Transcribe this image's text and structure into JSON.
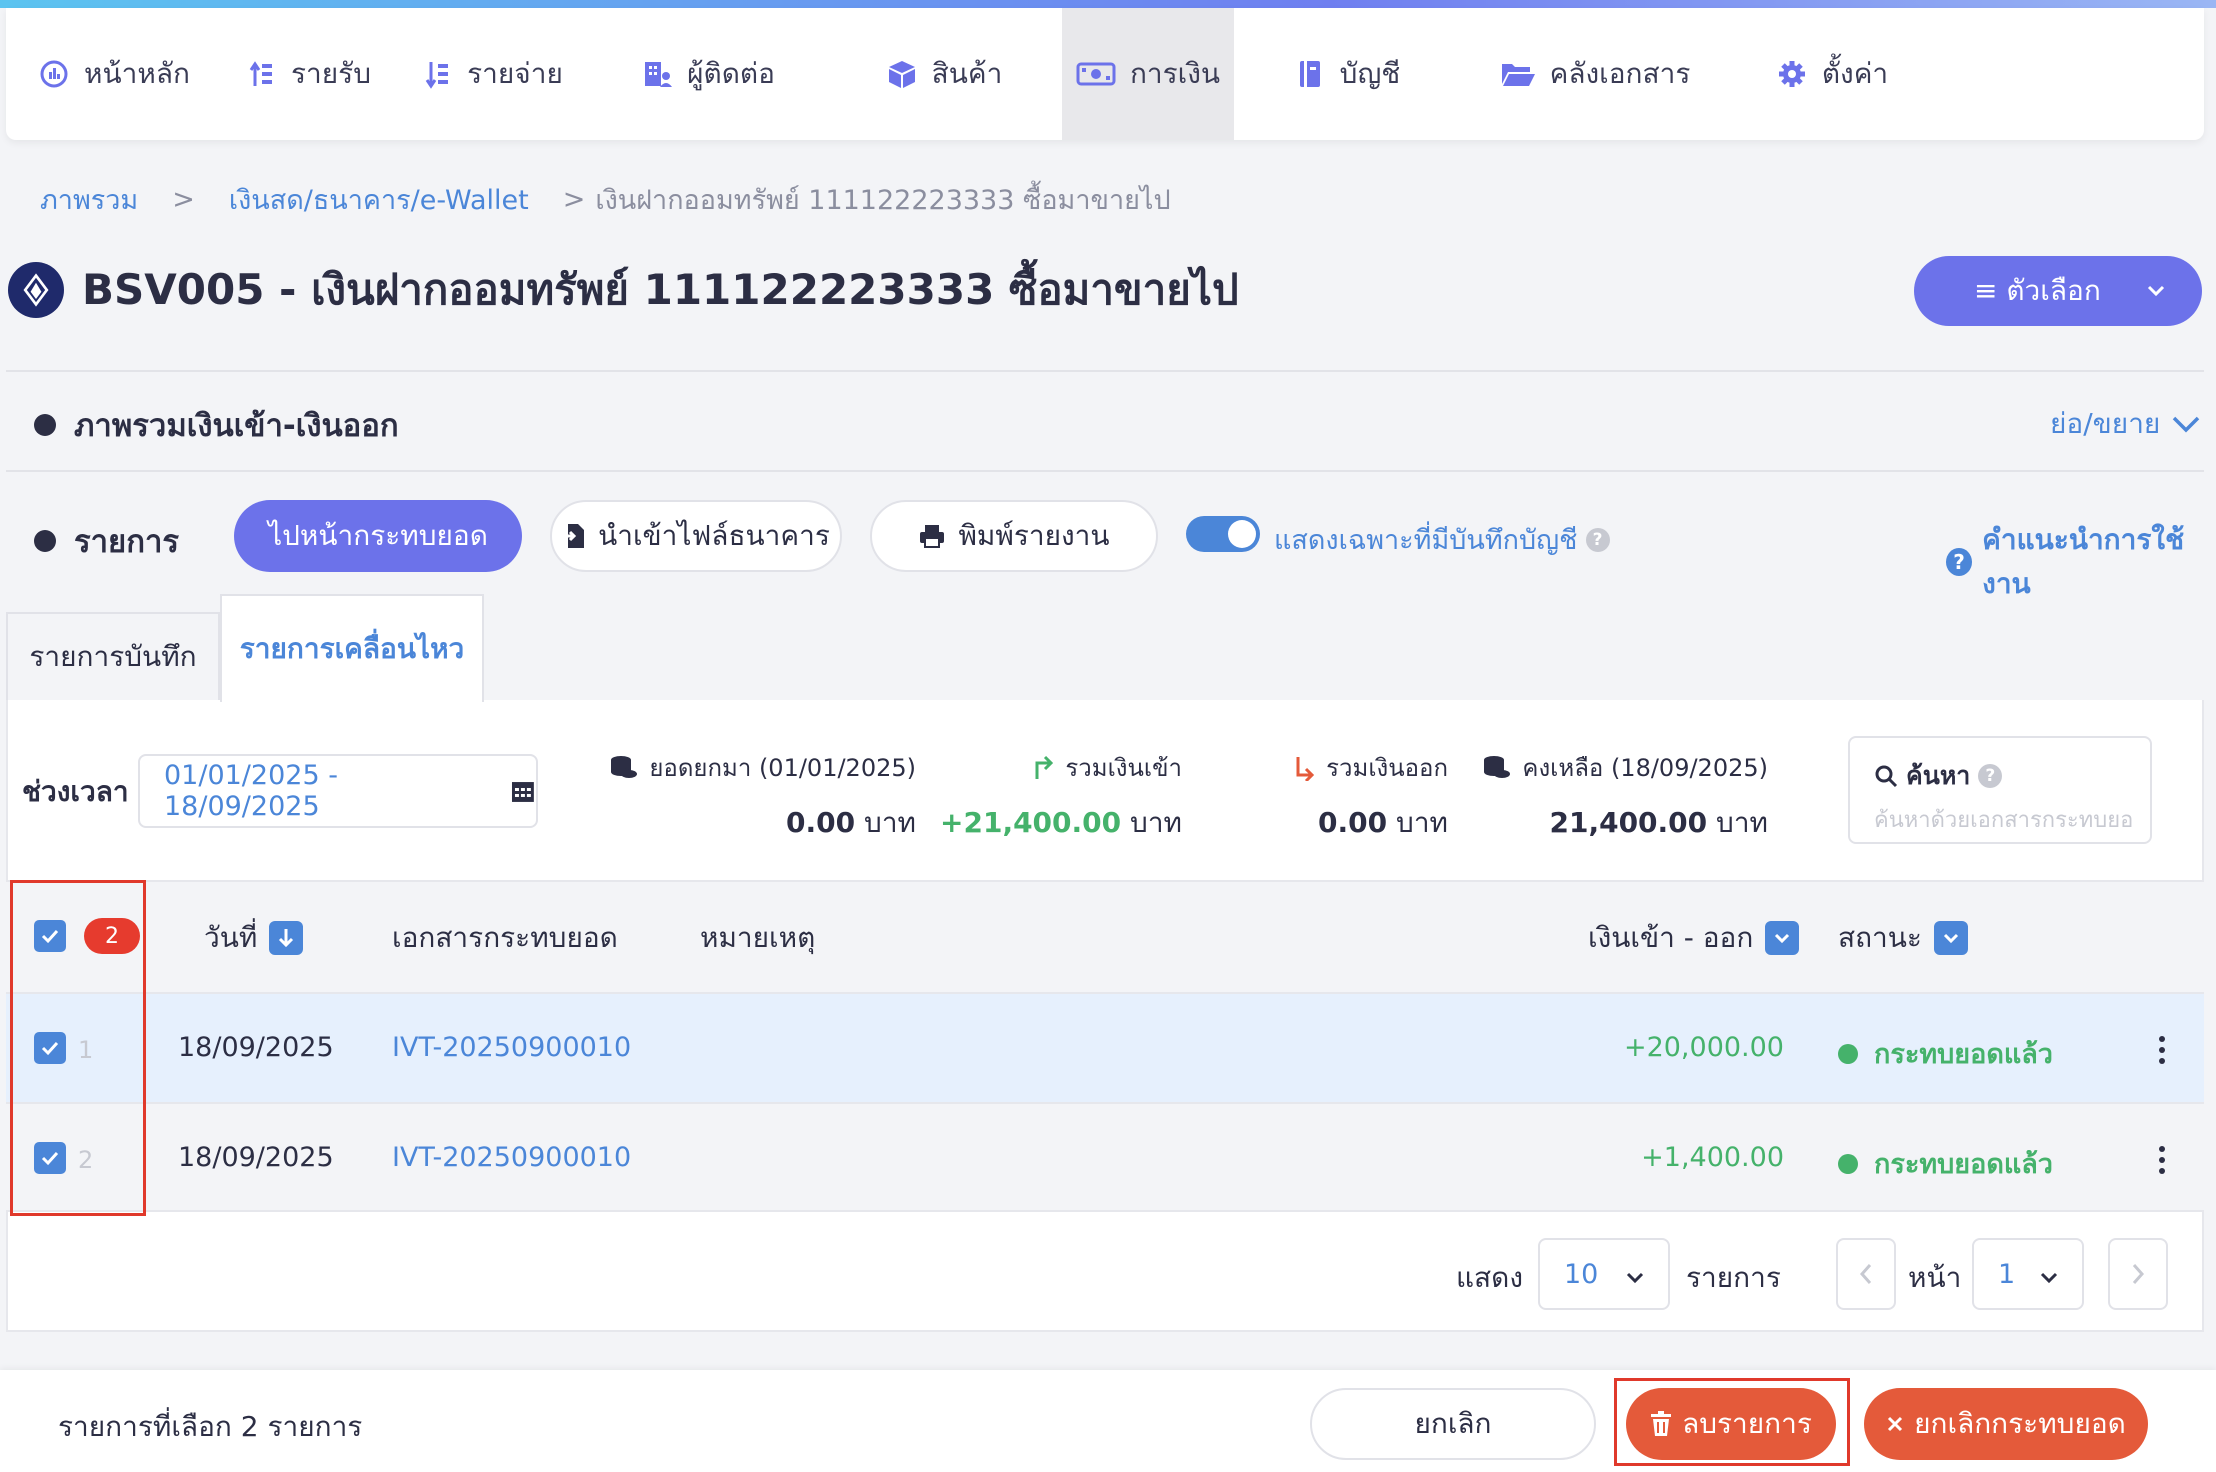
{
  "nav": {
    "items": [
      {
        "label": "หน้าหลัก",
        "icon": "dashboard-icon"
      },
      {
        "label": "รายรับ",
        "icon": "income-icon"
      },
      {
        "label": "รายจ่าย",
        "icon": "expense-icon"
      },
      {
        "label": "ผู้ติดต่อ",
        "icon": "contacts-icon"
      },
      {
        "label": "สินค้า",
        "icon": "box-icon"
      },
      {
        "label": "การเงิน",
        "icon": "money-icon",
        "active": true
      },
      {
        "label": "บัญชี",
        "icon": "ledger-icon"
      },
      {
        "label": "คลังเอกสาร",
        "icon": "folder-icon"
      },
      {
        "label": "ตั้งค่า",
        "icon": "gear-icon"
      }
    ]
  },
  "breadcrumb": {
    "items": [
      "ภาพรวม",
      "เงินสด/ธนาคาร/e-Wallet"
    ],
    "separator": ">",
    "current": "เงินฝากออมทรัพย์ 111122223333 ซื้อมาขายไป"
  },
  "page": {
    "title": "BSV005 - เงินฝากออมทรัพย์ 111122223333 ซื้อมาขายไป",
    "options_label": "≡ ตัวเลือก"
  },
  "overview": {
    "label": "ภาพรวมเงินเข้า-เงินออก",
    "collapse_label": "ย่อ/ขยาย"
  },
  "toolbar": {
    "section_label": "รายการ",
    "reconcile_label": "ไปหน้ากระทบยอด",
    "import_label": "นำเข้าไฟล์ธนาคาร",
    "print_label": "พิมพ์รายงาน",
    "toggle_label": "แสดงเฉพาะที่มีบันทึกบัญชี",
    "help_label": "คำแนะนำการใช้งาน"
  },
  "tabs": {
    "recorded": "รายการบันทึก",
    "movements": "รายการเคลื่อนไหว"
  },
  "filters": {
    "period_label": "ช่วงเวลา",
    "date_range": "01/01/2025 - 18/09/2025"
  },
  "summary": {
    "opening": {
      "label": "ยอดยกมา (01/01/2025)",
      "value": "0.00",
      "unit": "บาท"
    },
    "total_in": {
      "label": "รวมเงินเข้า",
      "value": "+21,400.00",
      "unit": "บาท"
    },
    "total_out": {
      "label": "รวมเงินออก",
      "value": "0.00",
      "unit": "บาท"
    },
    "balance": {
      "label": "คงเหลือ (18/09/2025)",
      "value": "21,400.00",
      "unit": "บาท"
    }
  },
  "search": {
    "label": "ค้นหา",
    "placeholder": "ค้นหาด้วยเอกสารกระทบยอด"
  },
  "table": {
    "selected_count": "2",
    "columns": {
      "date": "วันที่",
      "doc": "เอกสารกระทบยอด",
      "note": "หมายเหตุ",
      "amount": "เงินเข้า - ออก",
      "status": "สถานะ"
    },
    "rows": [
      {
        "num": "1",
        "date": "18/09/2025",
        "doc": "IVT-20250900010",
        "note": "",
        "amount": "+20,000.00",
        "status": "กระทบยอดแล้ว"
      },
      {
        "num": "2",
        "date": "18/09/2025",
        "doc": "IVT-20250900010",
        "note": "",
        "amount": "+1,400.00",
        "status": "กระทบยอดแล้ว"
      }
    ]
  },
  "pagination": {
    "show_label": "แสดง",
    "page_size": "10",
    "items_label": "รายการ",
    "page_label": "หน้า",
    "page": "1"
  },
  "footer": {
    "selected_text": "รายการที่เลือก 2 รายการ",
    "cancel_label": "ยกเลิก",
    "delete_label": "ลบรายการ",
    "unreconcile_label": "ยกเลิกกระทบยอด"
  },
  "colors": {
    "primary": "#6c72ea",
    "link": "#4b86d8",
    "success": "#45b26b",
    "danger": "#e45a3a",
    "highlight_outline": "#e0392b"
  }
}
